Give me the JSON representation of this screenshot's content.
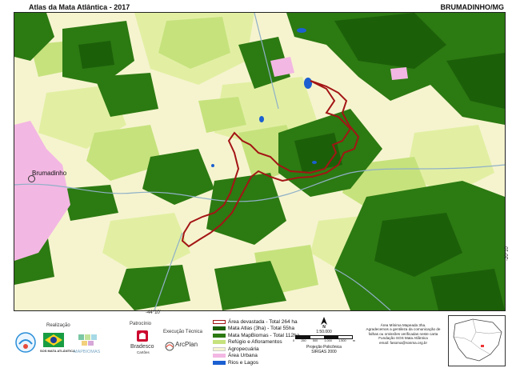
{
  "header": {
    "title": "Atlas da Mata Atlântica - 2017",
    "location": "BRUMADINHO/MG"
  },
  "map": {
    "town_label": "Brumadinho",
    "coord_x": "-44°10'",
    "coord_y": "-20°10'",
    "colors": {
      "agro": "#f6f4cf",
      "forest": "#2c7a12",
      "forest_dark": "#1c5f09",
      "light_green": "#c6e27d",
      "pale_green": "#e2efa3",
      "urban": "#f3b7e3",
      "water": "#1b5fd1",
      "rivers": "#8fb0c7",
      "devastated": "#a31515"
    }
  },
  "footer": {
    "realizacao_label": "Realização",
    "patrocinio_label": "Patrocínio",
    "execucao_label": "Execução Técnica",
    "sos_label": "SOS MATA ATLÂNTICA",
    "mapbiomas_label": "MAPBIOMAS",
    "bradesco_label": "Bradesco",
    "bradesco_sub": "Cartões",
    "arcplan_label": "ArcPlan"
  },
  "legend": {
    "items": [
      {
        "label": "Área devastada - Total 264 ha",
        "type": "outline",
        "color": "#a31515"
      },
      {
        "label": "Mata Atlas (3ha) - Total 55ha",
        "type": "fill",
        "color": "#1c5f09"
      },
      {
        "label": "Mata MapBiomas - Total 112ha",
        "type": "fill",
        "color": "#2c7a12"
      },
      {
        "label": "Refúgio e Afloramentos",
        "type": "fill",
        "color": "#c6e27d"
      },
      {
        "label": "Agropecuária",
        "type": "fill",
        "color": "#f6f4cf"
      },
      {
        "label": "Área Urbana",
        "type": "fill",
        "color": "#f3b7e3"
      },
      {
        "label": "Rios e Lagos",
        "type": "fill",
        "color": "#1b5fd1"
      }
    ]
  },
  "scale": {
    "north": "N",
    "ratio": "1:50.000",
    "ticks": [
      "0",
      "250",
      "500",
      "1.000",
      "1.500"
    ],
    "unit": "m",
    "projection": "Projeção Policônica",
    "datum": "SIRGAS 2000"
  },
  "note": {
    "line1": "Área Mínima Mapeada 3ha.",
    "line2": "Agradecemos a gentileza da comunicação de",
    "line3": "falhas ou omissões verificadas neste carta",
    "line4": "Fundação SOS Mata Atlântica",
    "line5": "email: fasoma@sosma.org.br"
  }
}
